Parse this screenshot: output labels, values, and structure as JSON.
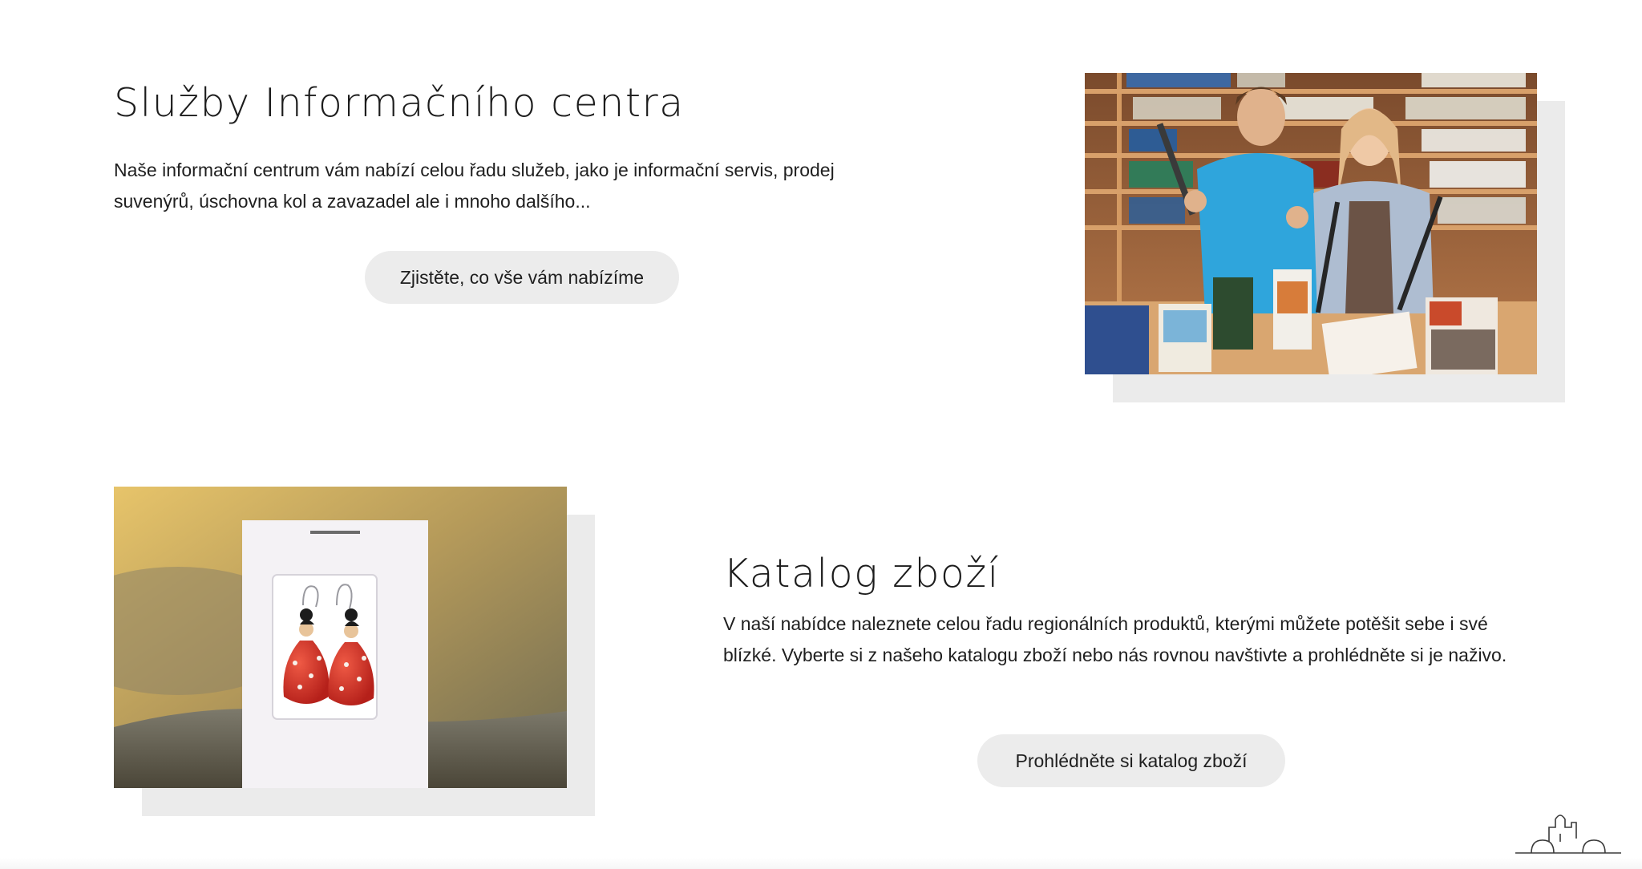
{
  "services": {
    "title": "Služby Informačního centra",
    "text": "Naše informační centrum vám nabízí celou řadu služeb, jako je informační servis, prodej suvenýrů, úschovna kol a zavazadel ale i mnoho dalšího...",
    "button_label": "Zjistěte, co vše vám nabízíme"
  },
  "catalog": {
    "title": "Katalog zboží",
    "text": "V naší nabídce naleznete celou řadu regionálních produktů, kterými můžete potěšit sebe i své blízké. Vyberte si z našeho katalogu zboží nebo nás rovnou navštivte a prohlédněte si je naživo.",
    "button_label": "Prohlédněte si katalog zboží"
  },
  "icons": {
    "footer_logo": "town-skyline-icon"
  }
}
